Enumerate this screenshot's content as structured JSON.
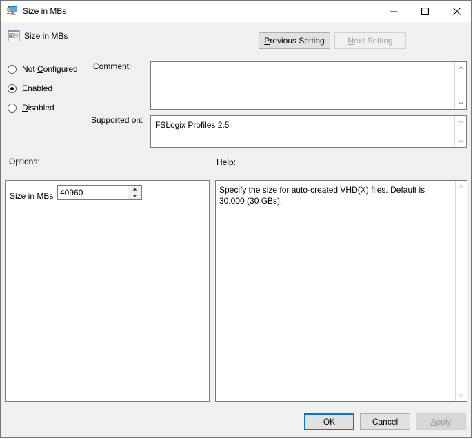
{
  "window": {
    "title": "Size in MBs",
    "title_icon": "computer-monitor-icon",
    "minimize_label": "—",
    "maximize_label": "□",
    "close_label": "✕"
  },
  "header": {
    "setting_name": "Size in MBs",
    "setting_icon": "policy-setting-icon",
    "previous_setting": "Previous Setting",
    "previous_setting_accel": "P",
    "next_setting": "Next Setting",
    "next_setting_accel": "N",
    "next_setting_enabled": false
  },
  "state": {
    "options": [
      {
        "label": "Not Configured",
        "accel": "C",
        "selected": false
      },
      {
        "label": "Enabled",
        "accel": "E",
        "selected": true
      },
      {
        "label": "Disabled",
        "accel": "D",
        "selected": false
      }
    ]
  },
  "comment": {
    "label": "Comment:",
    "value": "",
    "placeholder": ""
  },
  "supported_on": {
    "label": "Supported on:",
    "value": "FSLogix Profiles 2.5"
  },
  "options_pane": {
    "label": "Options:",
    "size_label": "Size in MBs",
    "size_value": "40960"
  },
  "help_pane": {
    "label": "Help:",
    "text": "Specify the size for auto-created VHD(X) files. Default is 30,000 (30 GBs)."
  },
  "footer": {
    "ok": "OK",
    "cancel": "Cancel",
    "apply": "Apply",
    "apply_accel": "A",
    "apply_enabled": false
  },
  "colors": {
    "dialog_background": "#f0f0f0",
    "titlebar_background": "#ffffff",
    "field_background": "#ffffff",
    "border": "#7a7a7a",
    "focus_accent": "#0078d7",
    "disabled_text": "#a0a0a0"
  }
}
